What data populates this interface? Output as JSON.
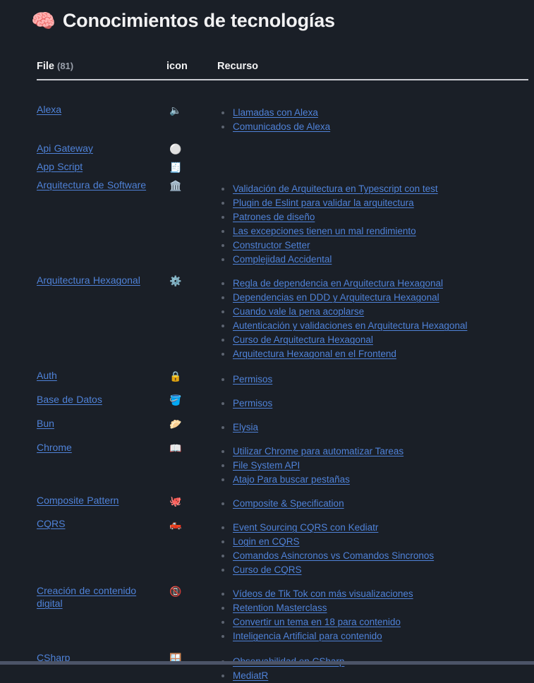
{
  "header": {
    "emoji_icon": "brain-icon",
    "emoji_glyph": "🧠",
    "title": "Conocimientos de tecnologías"
  },
  "table": {
    "columns": {
      "file": "File",
      "file_count": "(81)",
      "icon": "icon",
      "recurso": "Recurso"
    },
    "accent_link_color": "#4f82d8",
    "background_color": "#1a1f27",
    "rows": [
      {
        "file": "Alexa",
        "icon_name": "speaker-icon",
        "icon_glyph": "🔈",
        "resources": [
          "Llamadas con Alexa",
          "Comunicados de Alexa"
        ]
      },
      {
        "file": "Api Gateway",
        "icon_name": "white-circle-icon",
        "icon_glyph": "⚪",
        "resources": []
      },
      {
        "file": "App Script",
        "icon_name": "receipt-icon",
        "icon_glyph": "🧾",
        "resources": []
      },
      {
        "file": "Arquitectura de Software",
        "icon_name": "classical-building-icon",
        "icon_glyph": "🏛️",
        "resources": [
          "Validación de Arquitectura en Typescript con test",
          "Plugin de Eslint para validar la arquitectura",
          "Patrones de diseño",
          "Las excepciones tienen un mal rendimiento",
          "Constructor Setter",
          "Complejidad Accidental"
        ]
      },
      {
        "file": "Arquitectura Hexagonal",
        "icon_name": "purple-gear-icon",
        "icon_glyph": "⚙️",
        "resources": [
          "Regla de dependencia en Arquitectura Hexagonal",
          "Dependencias en DDD y Arquitectura Hexagonal",
          "Cuando vale la pena acoplarse",
          "Autenticación y validaciones en Arquitectura Hexagonal",
          "Curso de Arquitectura Hexagonal",
          "Arquitectura Hexagonal en el Frontend"
        ]
      },
      {
        "file": "Auth",
        "icon_name": "lock-icon",
        "icon_glyph": "🔒",
        "resources": [
          "Permisos"
        ]
      },
      {
        "file": "Base de Datos",
        "icon_name": "bucket-icon",
        "icon_glyph": "🪣",
        "resources": [
          "Permisos"
        ]
      },
      {
        "file": "Bun",
        "icon_name": "dumpling-icon",
        "icon_glyph": "🥟",
        "resources": [
          "Elysia"
        ]
      },
      {
        "file": "Chrome",
        "icon_name": "open-book-icon",
        "icon_glyph": "📖",
        "resources": [
          "Utilizar Chrome para automatizar Tareas",
          "File System API",
          "Atajo Para buscar pestañas"
        ]
      },
      {
        "file": "Composite Pattern",
        "icon_name": "octopus-icon",
        "icon_glyph": "🐙",
        "resources": [
          "Composite & Specification"
        ]
      },
      {
        "file": "CQRS",
        "icon_name": "pickup-truck-icon",
        "icon_glyph": "🛻",
        "resources": [
          "Event Sourcing CQRS con Kediatr",
          "Login en CQRS",
          "Comandos Asincronos vs Comandos Sincronos",
          "Curso de CQRS"
        ]
      },
      {
        "file": "Creación de contenido digital",
        "icon_name": "no-mobile-phones-icon",
        "icon_glyph": "📵",
        "resources": [
          "Vídeos de Tik Tok con más visualizaciones",
          "Retention Masterclass",
          "Convertir un tema en 18 para contenido",
          "Inteligencia Artificial para contenido"
        ]
      },
      {
        "file": "CSharp",
        "icon_name": "window-icon",
        "icon_glyph": "🪟",
        "resources": [
          "Observabilidad en CSharp",
          "MediatR"
        ]
      }
    ]
  }
}
